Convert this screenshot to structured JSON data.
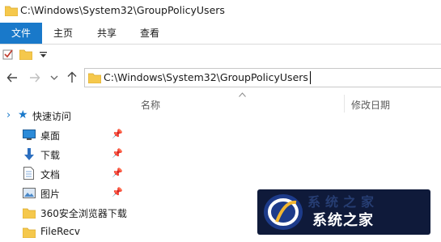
{
  "window": {
    "title": "C:\\Windows\\System32\\GroupPolicyUsers",
    "icon": "folder-icon"
  },
  "ribbon": {
    "tabs": [
      {
        "label": "文件",
        "active": true
      },
      {
        "label": "主页"
      },
      {
        "label": "共享"
      },
      {
        "label": "查看"
      }
    ]
  },
  "quick_access_toolbar": {
    "items": [
      "properties-check-icon",
      "new-folder-icon",
      "customize-dropdown-icon"
    ]
  },
  "navigation": {
    "back": "back-arrow-icon",
    "forward": "forward-arrow-icon",
    "recent": "recent-locations-chevron-icon",
    "up": "up-arrow-icon"
  },
  "address_bar": {
    "path": "C:\\Windows\\System32\\GroupPolicyUsers"
  },
  "nav_pane": {
    "quick_access_label": "快速访问",
    "items": [
      {
        "label": "桌面",
        "icon": "desktop-icon",
        "pinned": true
      },
      {
        "label": "下载",
        "icon": "download-icon",
        "pinned": true
      },
      {
        "label": "文档",
        "icon": "document-icon",
        "pinned": true
      },
      {
        "label": "图片",
        "icon": "pictures-icon",
        "pinned": true
      },
      {
        "label": "360安全浏览器下载",
        "icon": "folder-icon",
        "pinned": false
      },
      {
        "label": "FileRecv",
        "icon": "folder-icon",
        "pinned": false
      }
    ]
  },
  "file_list": {
    "columns": [
      {
        "label": "名称",
        "sorted": true
      },
      {
        "label": "修改日期"
      }
    ],
    "rows": []
  },
  "watermark": {
    "text": "系统之家",
    "faint_text": "系统之家"
  },
  "colors": {
    "accent": "#1979ca",
    "folder": "#f5c84c",
    "watermark_bg": "#0f1a3a"
  }
}
